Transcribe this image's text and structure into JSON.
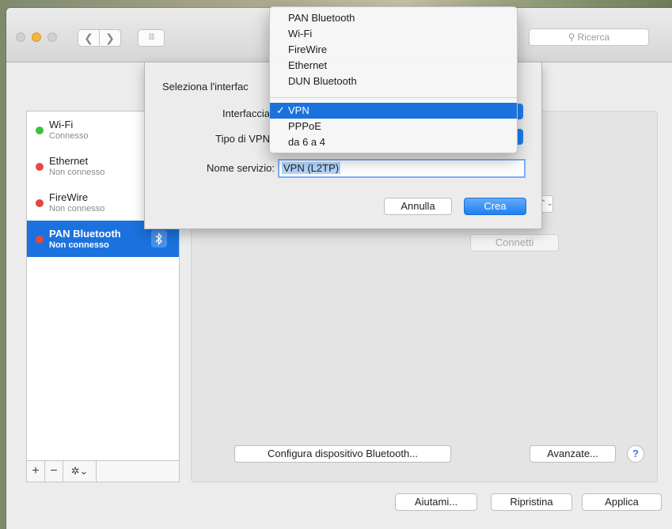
{
  "titlebar": {
    "back": "❮",
    "forward": "❯",
    "grid": "⁞⁞⁞⁞",
    "search_placeholder": "Ricerca",
    "search_icon": "⚲"
  },
  "services": [
    {
      "name": "Wi-Fi",
      "status": "Connesso",
      "status_color": "#3fbf3a"
    },
    {
      "name": "Ethernet",
      "status": "Non connesso",
      "status_color": "#e8473d"
    },
    {
      "name": "FireWire",
      "status": "Non connesso",
      "status_color": "#e8473d"
    },
    {
      "name": "PAN Bluetooth",
      "status": "Non connesso",
      "status_color": "#e8473d",
      "selected": true,
      "icon": "bluetooth-icon"
    }
  ],
  "sidebar_buttons": {
    "add": "+",
    "remove": "−",
    "gear": "✲⌄"
  },
  "pane": {
    "connect_button": "Connetti",
    "configure_button": "Configura dispositivo Bluetooth...",
    "advanced_button": "Avanzate...",
    "help_button": "?"
  },
  "footer": {
    "help": "Aiutami...",
    "revert": "Ripristina",
    "apply": "Applica"
  },
  "sheet": {
    "title": "Seleziona l'interfac",
    "interface_label": "Interfaccia",
    "vpn_type_label": "Tipo di VPN",
    "service_name_label": "Nome servizio:",
    "service_name_value": "VPN (L2TP)",
    "cancel": "Annulla",
    "create": "Crea"
  },
  "dropdown": {
    "items_top": [
      "PAN Bluetooth",
      "Wi-Fi",
      "FireWire",
      "Ethernet",
      "DUN Bluetooth"
    ],
    "checked_item": "VPN",
    "checkmark": "✓",
    "items_bottom": [
      "PPPoE",
      "da 6 a 4"
    ]
  },
  "colors": {
    "accent": "#1b72de",
    "connected": "#3fbf3a",
    "disconnected": "#e8473d"
  }
}
